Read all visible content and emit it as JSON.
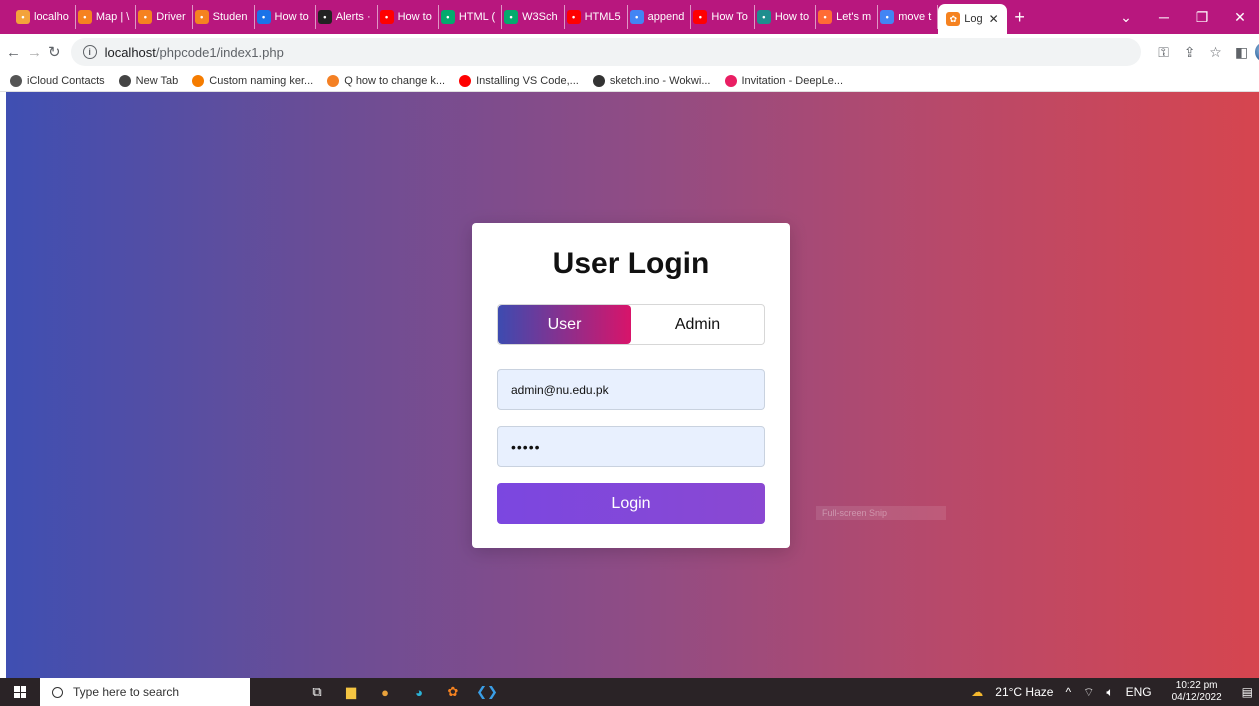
{
  "browser": {
    "tabs": [
      {
        "label": "localho",
        "color": "#f3a33b"
      },
      {
        "label": "Map | \\",
        "color": "#f58220"
      },
      {
        "label": "Driver",
        "color": "#f58220"
      },
      {
        "label": "Studen",
        "color": "#f58220"
      },
      {
        "label": "How to",
        "color": "#1a73e8"
      },
      {
        "label": "Alerts ·",
        "color": "#222"
      },
      {
        "label": "How to",
        "color": "#ff0000"
      },
      {
        "label": "HTML (",
        "color": "#04aa6d"
      },
      {
        "label": "W3Sch",
        "color": "#04aa6d"
      },
      {
        "label": "HTML5",
        "color": "#ff0000"
      },
      {
        "label": "append",
        "color": "#4285f4"
      },
      {
        "label": "How To",
        "color": "#ff0000"
      },
      {
        "label": "How to",
        "color": "#1e8e8e"
      },
      {
        "label": "Let's m",
        "color": "#ff6b35"
      },
      {
        "label": "move t",
        "color": "#4285f4"
      }
    ],
    "active_tab": "Log",
    "new_tab": "+",
    "url_host": "localhost",
    "url_path": "/phpcode1/index1.php"
  },
  "bookmarks": [
    {
      "label": "iCloud Contacts",
      "color": "#555"
    },
    {
      "label": "New Tab",
      "color": "#444"
    },
    {
      "label": "Custom naming ker...",
      "color": "#f57c00"
    },
    {
      "label": "Q how to change k...",
      "color": "#f48024"
    },
    {
      "label": "Installing VS Code,...",
      "color": "#ff0000"
    },
    {
      "label": "sketch.ino - Wokwi...",
      "color": "#333"
    },
    {
      "label": "Invitation - DeepLe...",
      "color": "#e91e63"
    }
  ],
  "login": {
    "title": "User Login",
    "tab_user": "User",
    "tab_admin": "Admin",
    "email_value": "admin@nu.edu.pk",
    "password_value": "•••••",
    "button": "Login"
  },
  "overlay": {
    "ghost_text": "Full-screen Snip"
  },
  "taskbar": {
    "search_placeholder": "Type here to search",
    "weather": "21°C Haze",
    "language": "ENG",
    "time": "10:22 pm",
    "date": "04/12/2022"
  },
  "colors": {
    "tabstrip": "#b8177e",
    "gradient_start": "#3f4fb2",
    "gradient_end": "#d6454f",
    "toggle_start": "#3d4bb0",
    "toggle_end": "#d8146a",
    "login_button": "#7b47e0"
  }
}
